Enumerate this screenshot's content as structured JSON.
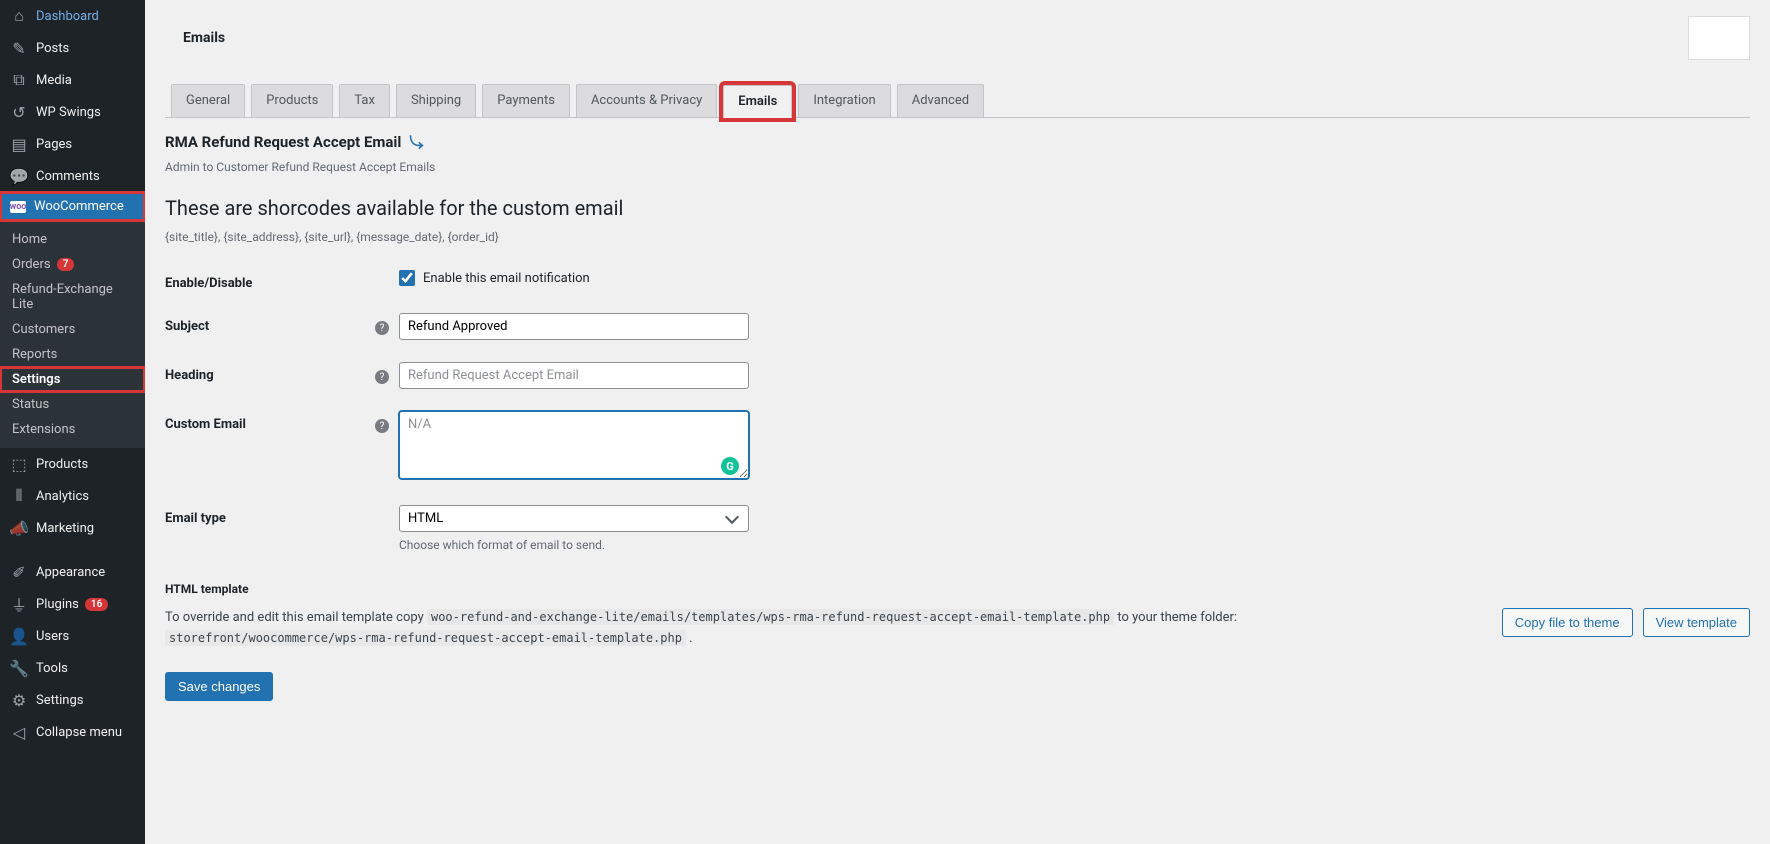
{
  "sidebar": {
    "items": [
      {
        "label": "Dashboard",
        "icon": "🏠"
      },
      {
        "label": "Posts",
        "icon": "📌"
      },
      {
        "label": "Media",
        "icon": "🖼"
      },
      {
        "label": "WP Swings",
        "icon": "↺"
      },
      {
        "label": "Pages",
        "icon": "📄"
      },
      {
        "label": "Comments",
        "icon": "💬"
      },
      {
        "label": "WooCommerce",
        "icon": "W",
        "active": true,
        "highlight": true
      },
      {
        "label": "Products",
        "icon": "📦"
      },
      {
        "label": "Analytics",
        "icon": "📊"
      },
      {
        "label": "Marketing",
        "icon": "📢"
      },
      {
        "label": "Appearance",
        "icon": "🖌"
      },
      {
        "label": "Plugins",
        "icon": "🔌",
        "badge": "16"
      },
      {
        "label": "Users",
        "icon": "👤"
      },
      {
        "label": "Tools",
        "icon": "🔧"
      },
      {
        "label": "Settings",
        "icon": "⚙"
      },
      {
        "label": "Collapse menu",
        "icon": "◀"
      }
    ],
    "submenu": [
      {
        "label": "Home"
      },
      {
        "label": "Orders",
        "badge": "7"
      },
      {
        "label": "Refund-Exchange Lite"
      },
      {
        "label": "Customers"
      },
      {
        "label": "Reports"
      },
      {
        "label": "Settings",
        "current": true,
        "highlight": true
      },
      {
        "label": "Status"
      },
      {
        "label": "Extensions"
      }
    ]
  },
  "page_title": "Emails",
  "tabs": [
    {
      "label": "General"
    },
    {
      "label": "Products"
    },
    {
      "label": "Tax"
    },
    {
      "label": "Shipping"
    },
    {
      "label": "Payments"
    },
    {
      "label": "Accounts & Privacy"
    },
    {
      "label": "Emails",
      "active": true,
      "highlight": true
    },
    {
      "label": "Integration"
    },
    {
      "label": "Advanced"
    }
  ],
  "content": {
    "title": "RMA Refund Request Accept Email",
    "subtitle": "Admin to Customer Refund Request Accept Emails",
    "section_heading": "These are shorcodes available for the custom email",
    "shortcodes": "{site_title}, {site_address}, {site_url}, {message_date}, {order_id}",
    "fields": {
      "enable_label": "Enable/Disable",
      "enable_checkbox_label": "Enable this email notification",
      "enable_checked": true,
      "subject_label": "Subject",
      "subject_value": "Refund Approved",
      "heading_label": "Heading",
      "heading_placeholder": "Refund Request Accept Email",
      "custom_email_label": "Custom Email",
      "custom_email_placeholder": "N/A",
      "email_type_label": "Email type",
      "email_type_value": "HTML",
      "email_type_hint": "Choose which format of email to send."
    },
    "template": {
      "heading": "HTML template",
      "text_before": "To override and edit this email template copy ",
      "path1": "woo-refund-and-exchange-lite/emails/templates/wps-rma-refund-request-accept-email-template.php",
      "text_mid": " to your theme folder: ",
      "path2": "storefront/woocommerce/wps-rma-refund-request-accept-email-template.php",
      "text_after": " .",
      "btn_copy": "Copy file to theme",
      "btn_view": "View template"
    },
    "save_button": "Save changes"
  }
}
